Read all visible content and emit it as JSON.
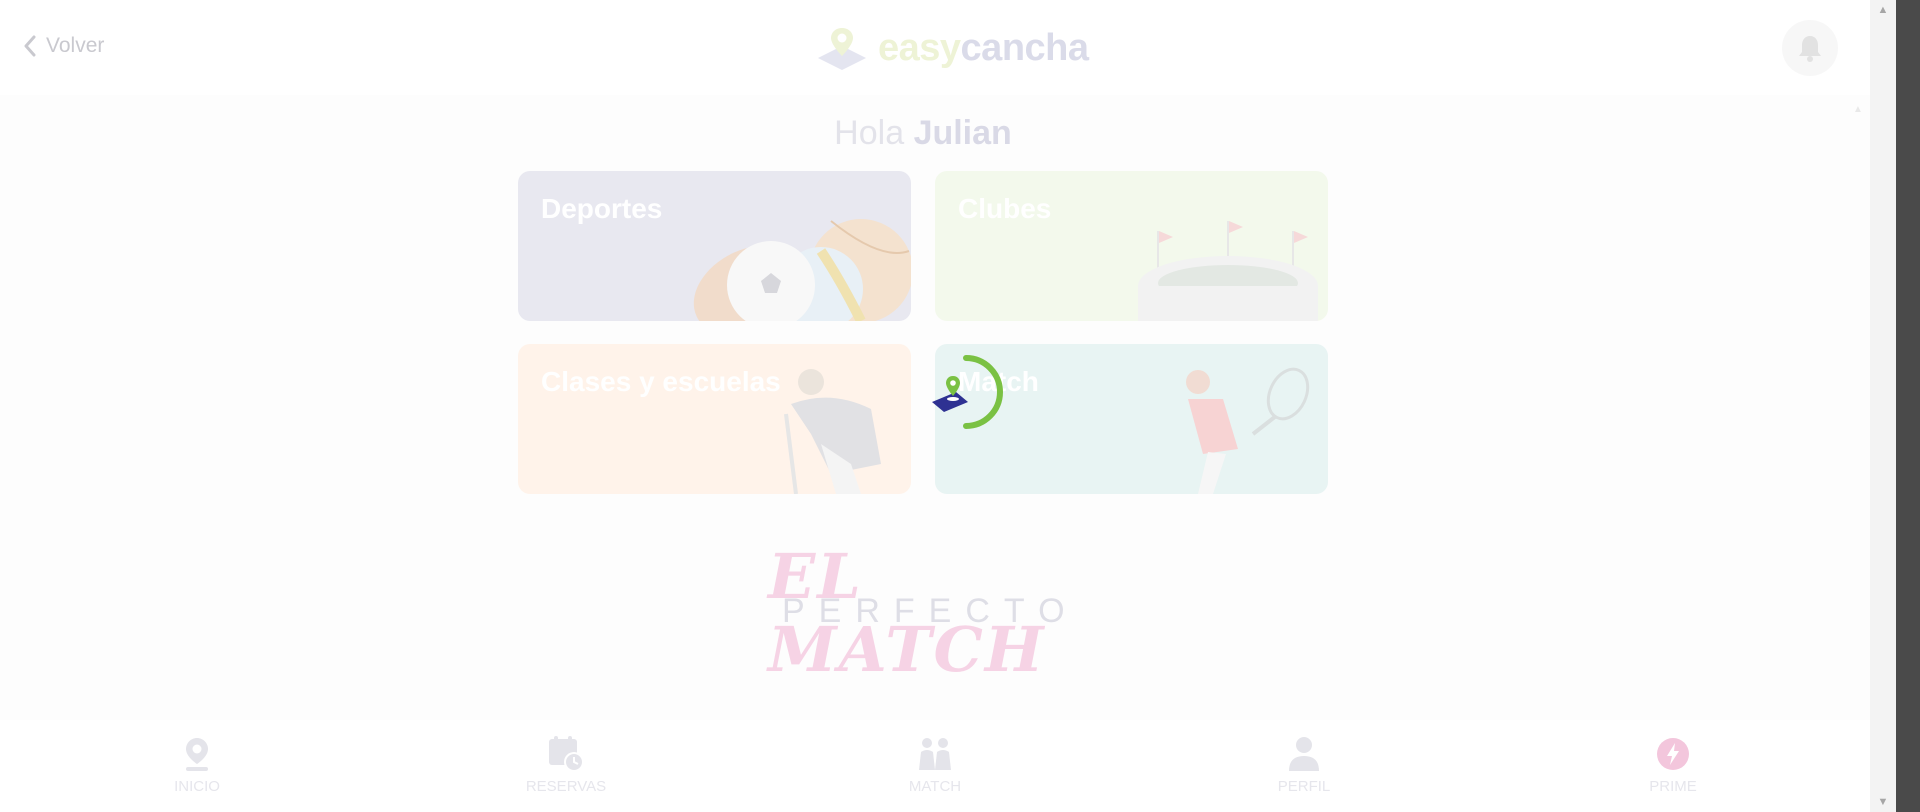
{
  "header": {
    "back_label": "Volver",
    "logo_easy": "easy",
    "logo_cancha": "cancha"
  },
  "greeting": {
    "prefix": "Hola",
    "name": "Julian"
  },
  "cards": {
    "deportes": "Deportes",
    "clubes": "Clubes",
    "clases": "Clases y escuelas",
    "match": "Match"
  },
  "promo": {
    "line1": "EL MATCH",
    "line2": "PERFECTO"
  },
  "bottom_nav": {
    "inicio": "INICIO",
    "reservas": "RESERVAS",
    "match": "MATCH",
    "perfil": "PERFIL",
    "prime": "PRIME"
  },
  "colors": {
    "brand_green": "#7ac143",
    "brand_navy": "#2e3192",
    "prime_pink": "#f3c6dc"
  },
  "icons": [
    "chevron-left-icon",
    "bell-icon",
    "map-pin-icon",
    "calendar-clock-icon",
    "players-icon",
    "person-icon",
    "prime-bolt-icon"
  ]
}
